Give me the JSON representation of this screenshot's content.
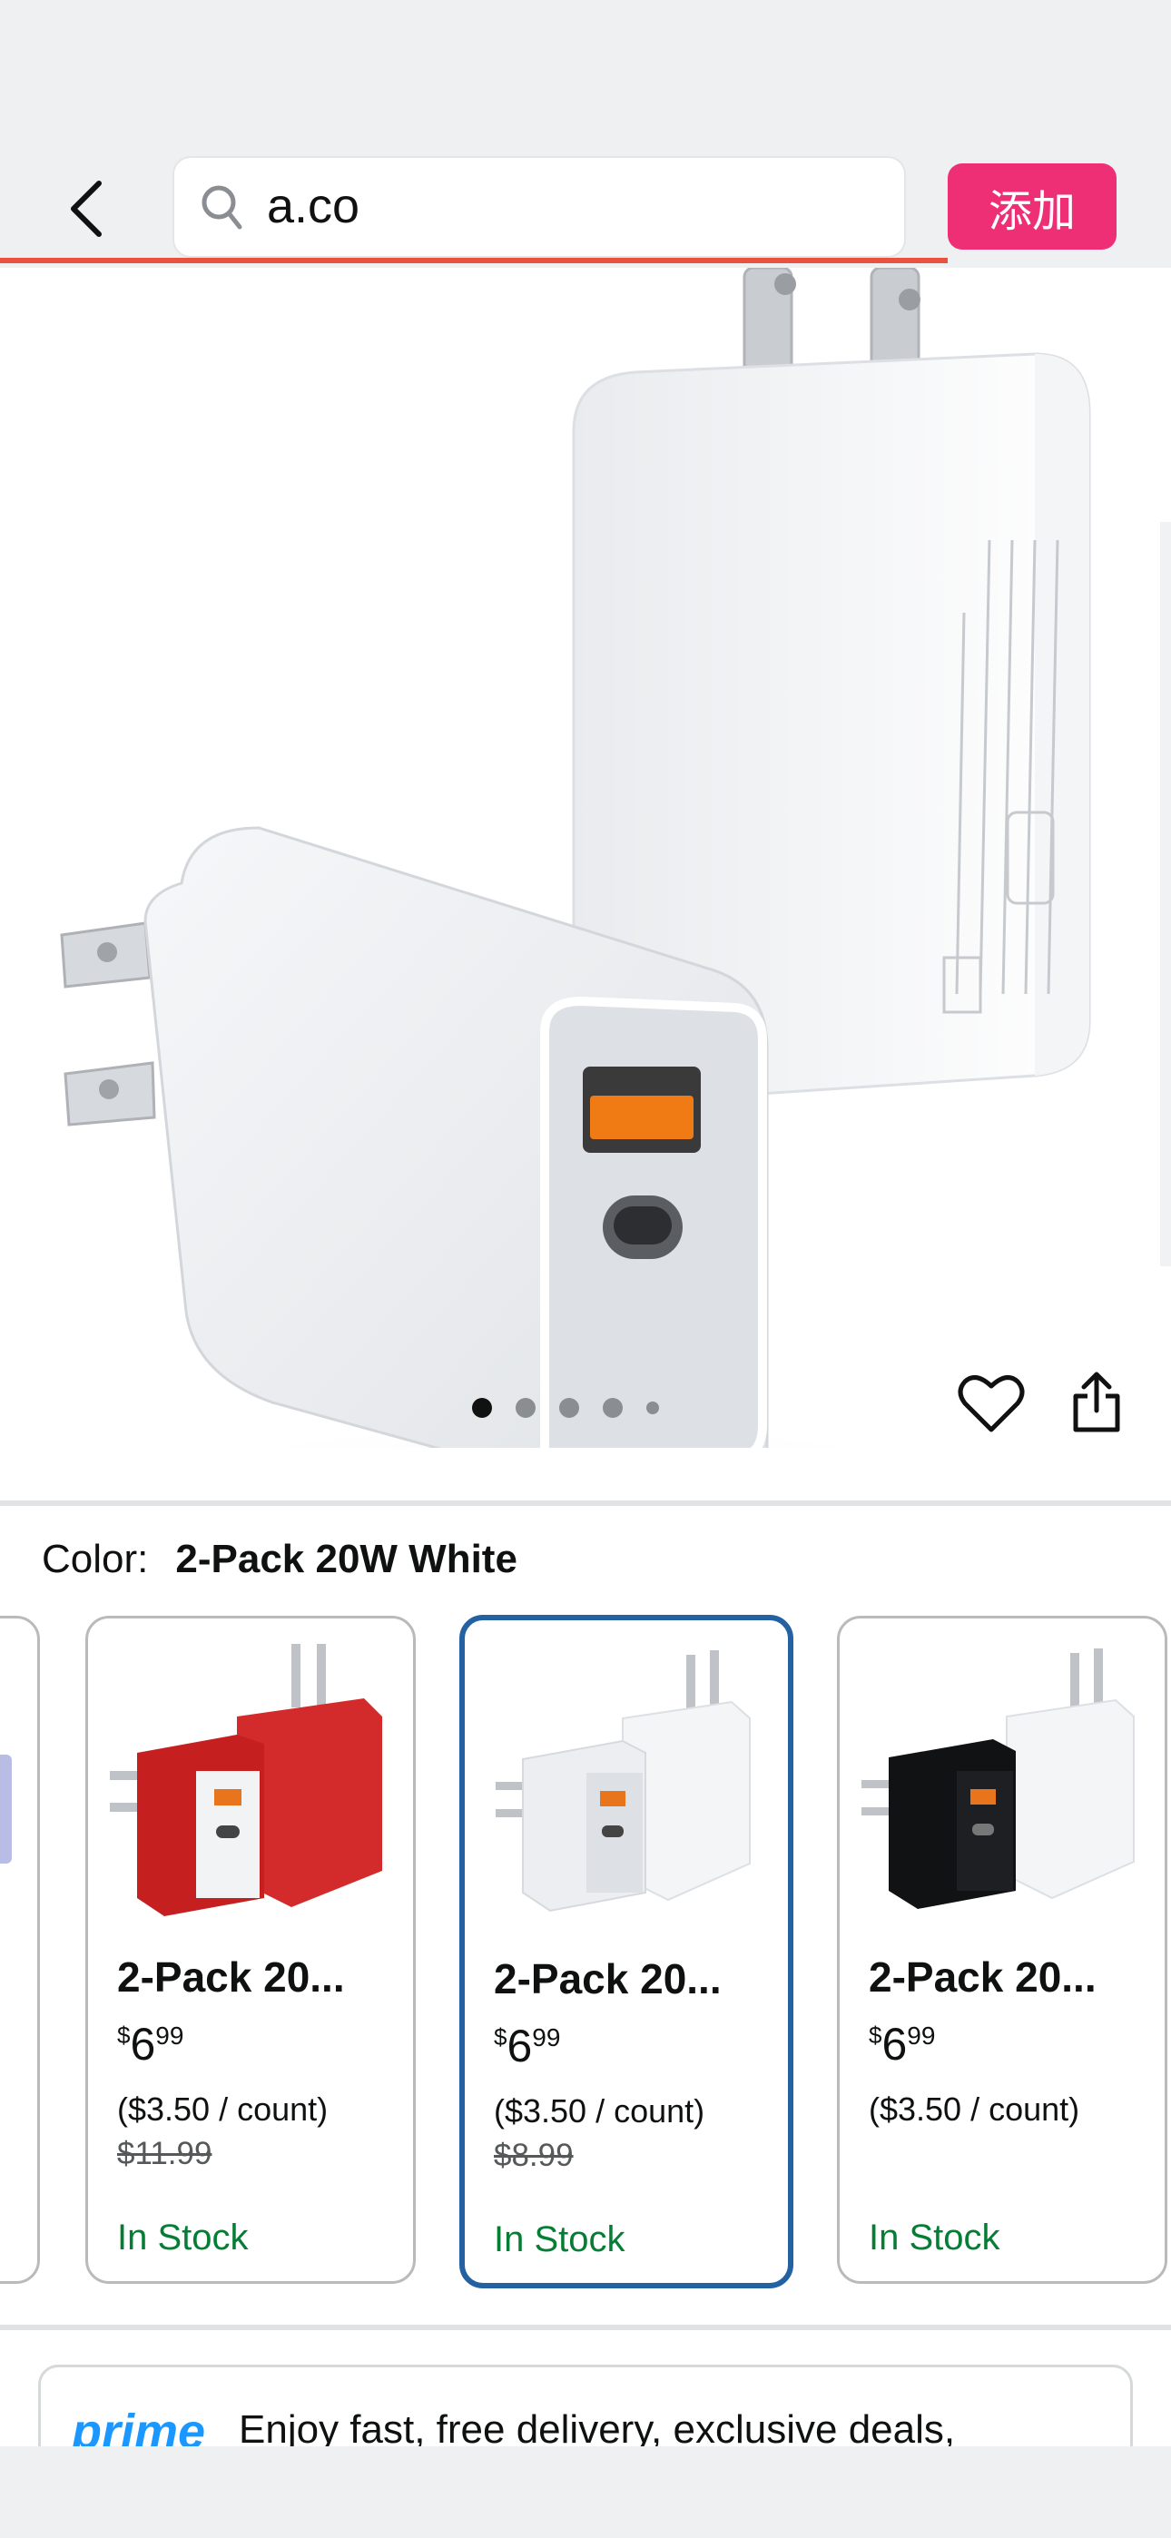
{
  "browser": {
    "url_text": "a.co",
    "add_label": "添加",
    "load_progress": 0.9
  },
  "gallery": {
    "image_count": 5,
    "active_index": 0
  },
  "color": {
    "label": "Color:",
    "selected": "2-Pack 20W White"
  },
  "variants": [
    {
      "name": "2-Pack 20...",
      "price_symbol": "$",
      "price_whole": "6",
      "price_cents": "99",
      "unit_price": "($3.50 / count)",
      "list_price": "$11.99",
      "stock": "In Stock",
      "color": "red"
    },
    {
      "name": "2-Pack 20...",
      "price_symbol": "$",
      "price_whole": "6",
      "price_cents": "99",
      "unit_price": "($3.50 / count)",
      "list_price": "$8.99",
      "stock": "In Stock",
      "color": "white"
    },
    {
      "name": "2-Pack 20...",
      "price_symbol": "$",
      "price_whole": "6",
      "price_cents": "99",
      "unit_price": "($3.50 / count)",
      "list_price": "",
      "stock": "In Stock",
      "color": "black"
    }
  ],
  "prime": {
    "logo": "prime",
    "text": "Enjoy fast, free delivery, exclusive deals,"
  },
  "colors": {
    "accent_add": "#ee2f76",
    "selected_border": "#2461a2",
    "in_stock": "#067d35",
    "prime_blue": "#1a98ff",
    "usb_orange": "#f07a14"
  }
}
